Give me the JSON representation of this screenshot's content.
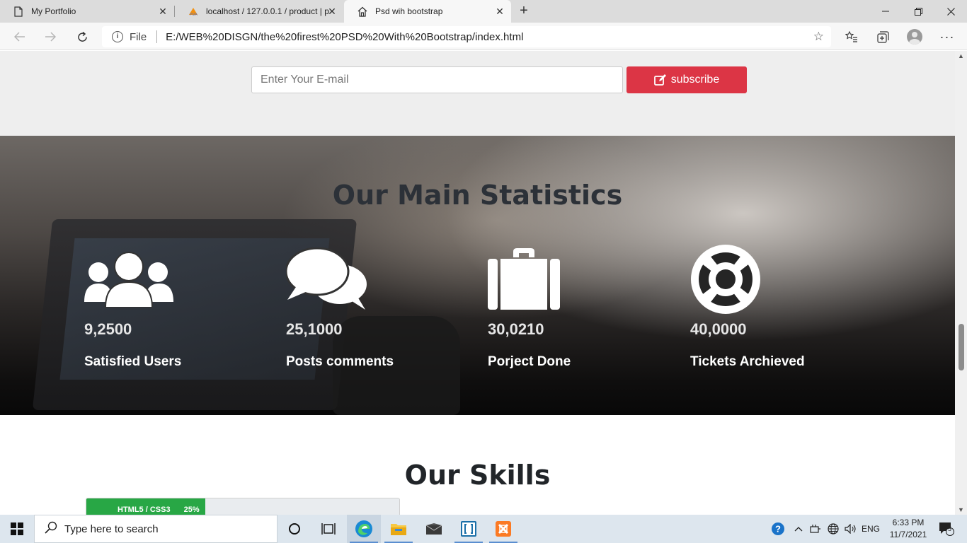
{
  "browser": {
    "tabs": [
      {
        "title": "My Portfolio",
        "icon": "page-icon",
        "active": false
      },
      {
        "title": "localhost / 127.0.0.1 / product | p",
        "icon": "phpmyadmin-icon",
        "active": false
      },
      {
        "title": "Psd wih bootstrap",
        "icon": "home-icon",
        "active": true
      }
    ],
    "address": {
      "scheme_label": "File",
      "url": "E:/WEB%20DISGN/the%20firest%20PSD%20With%20Bootstrap/index.html"
    }
  },
  "page": {
    "subscribe": {
      "email_placeholder": "Enter Your E-mail",
      "button_label": "subscribe",
      "button_color": "#dc3545"
    },
    "stats": {
      "title": "Our Main Statistics",
      "items": [
        {
          "icon": "users-icon",
          "number": "9,2500",
          "label": "Satisfied Users"
        },
        {
          "icon": "comments-icon",
          "number": "25,1000",
          "label": "Posts comments"
        },
        {
          "icon": "briefcase-icon",
          "number": "30,0210",
          "label": "Porject Done"
        },
        {
          "icon": "life-ring-icon",
          "number": "40,0000",
          "label": "Tickets Archieved"
        }
      ]
    },
    "skills": {
      "title": "Our Skills",
      "bars": [
        {
          "label": "HTML5 / CSS3",
          "percent_text": "25%",
          "fraction": 0.38,
          "color": "#28a745"
        }
      ]
    }
  },
  "taskbar": {
    "search_placeholder": "Type here to search",
    "language": "ENG",
    "time": "6:33 PM",
    "date": "11/7/2021",
    "notification_count": "5"
  }
}
